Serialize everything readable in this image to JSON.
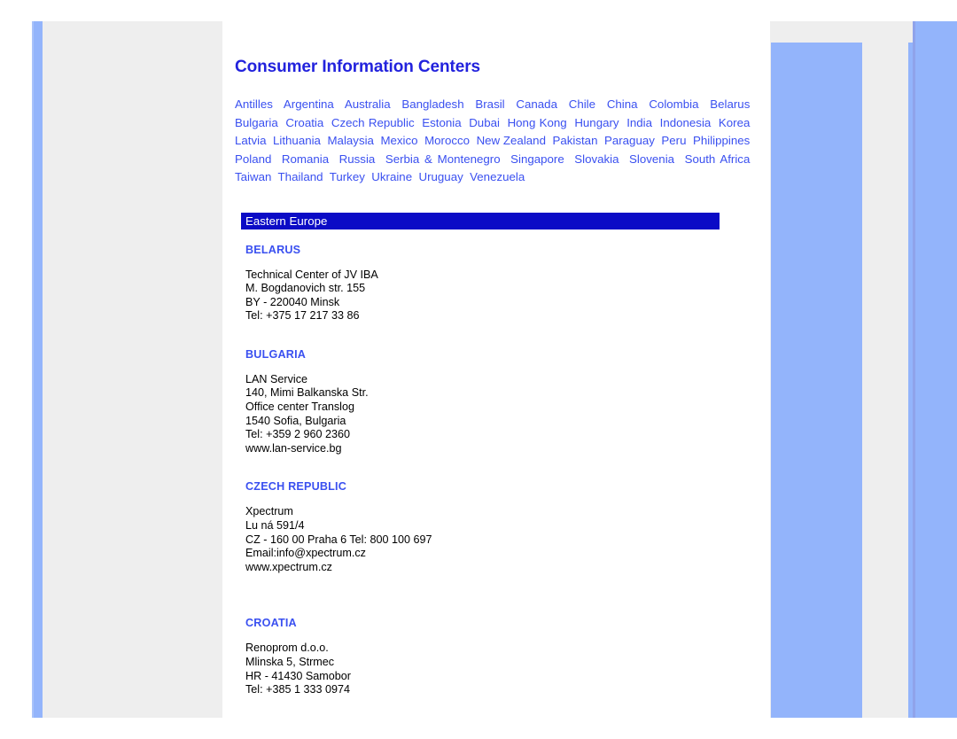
{
  "page": {
    "title": "Consumer Information Centers"
  },
  "countries": [
    "Antilles",
    "Argentina",
    "Australia",
    "Bangladesh",
    "Brasil",
    "Canada",
    "Chile",
    "China",
    "Colombia",
    "Belarus",
    "Bulgaria",
    "Croatia",
    "Czech Republic",
    "Estonia",
    "Dubai",
    "Hong Kong",
    "Hungary",
    "India",
    "Indonesia",
    "Korea",
    "Latvia",
    "Lithuania",
    "Malaysia",
    "Mexico",
    "Morocco",
    "New Zealand",
    "Pakistan",
    "Paraguay",
    "Peru",
    "Philippines",
    "Poland",
    "Romania",
    "Russia",
    "Serbia & Montenegro",
    "Singapore",
    "Slovakia",
    "Slovenia",
    "South Africa",
    "Taiwan",
    "Thailand",
    "Turkey",
    "Ukraine",
    "Uruguay",
    "Venezuela"
  ],
  "region": {
    "label": "Eastern Europe"
  },
  "sections": [
    {
      "heading": "BELARUS",
      "address": "Technical Center of JV IBA\nM. Bogdanovich str. 155\nBY - 220040 Minsk\nTel: +375 17 217 33 86"
    },
    {
      "heading": "BULGARIA",
      "address": "LAN Service\n140, Mimi Balkanska Str.\nOffice center Translog\n1540 Sofia, Bulgaria\nTel: +359 2 960 2360\nwww.lan-service.bg"
    },
    {
      "heading": "CZECH REPUBLIC",
      "address": "Xpectrum\nLu ná 591/4\nCZ - 160 00 Praha 6 Tel: 800 100 697\nEmail:info@xpectrum.cz\nwww.xpectrum.cz"
    },
    {
      "heading": "CROATIA",
      "address": "Renoprom d.o.o.\nMlinska 5, Strmec\nHR - 41430 Samobor\nTel: +385 1 333 0974"
    }
  ],
  "colors": {
    "link_blue": "#3a50f0",
    "title_blue": "#2222dd",
    "region_bar_blue": "#0b0bc6",
    "accent_light_blue": "#93b4fb",
    "panel_grey": "#eeeeee",
    "body_text": "#000000"
  }
}
